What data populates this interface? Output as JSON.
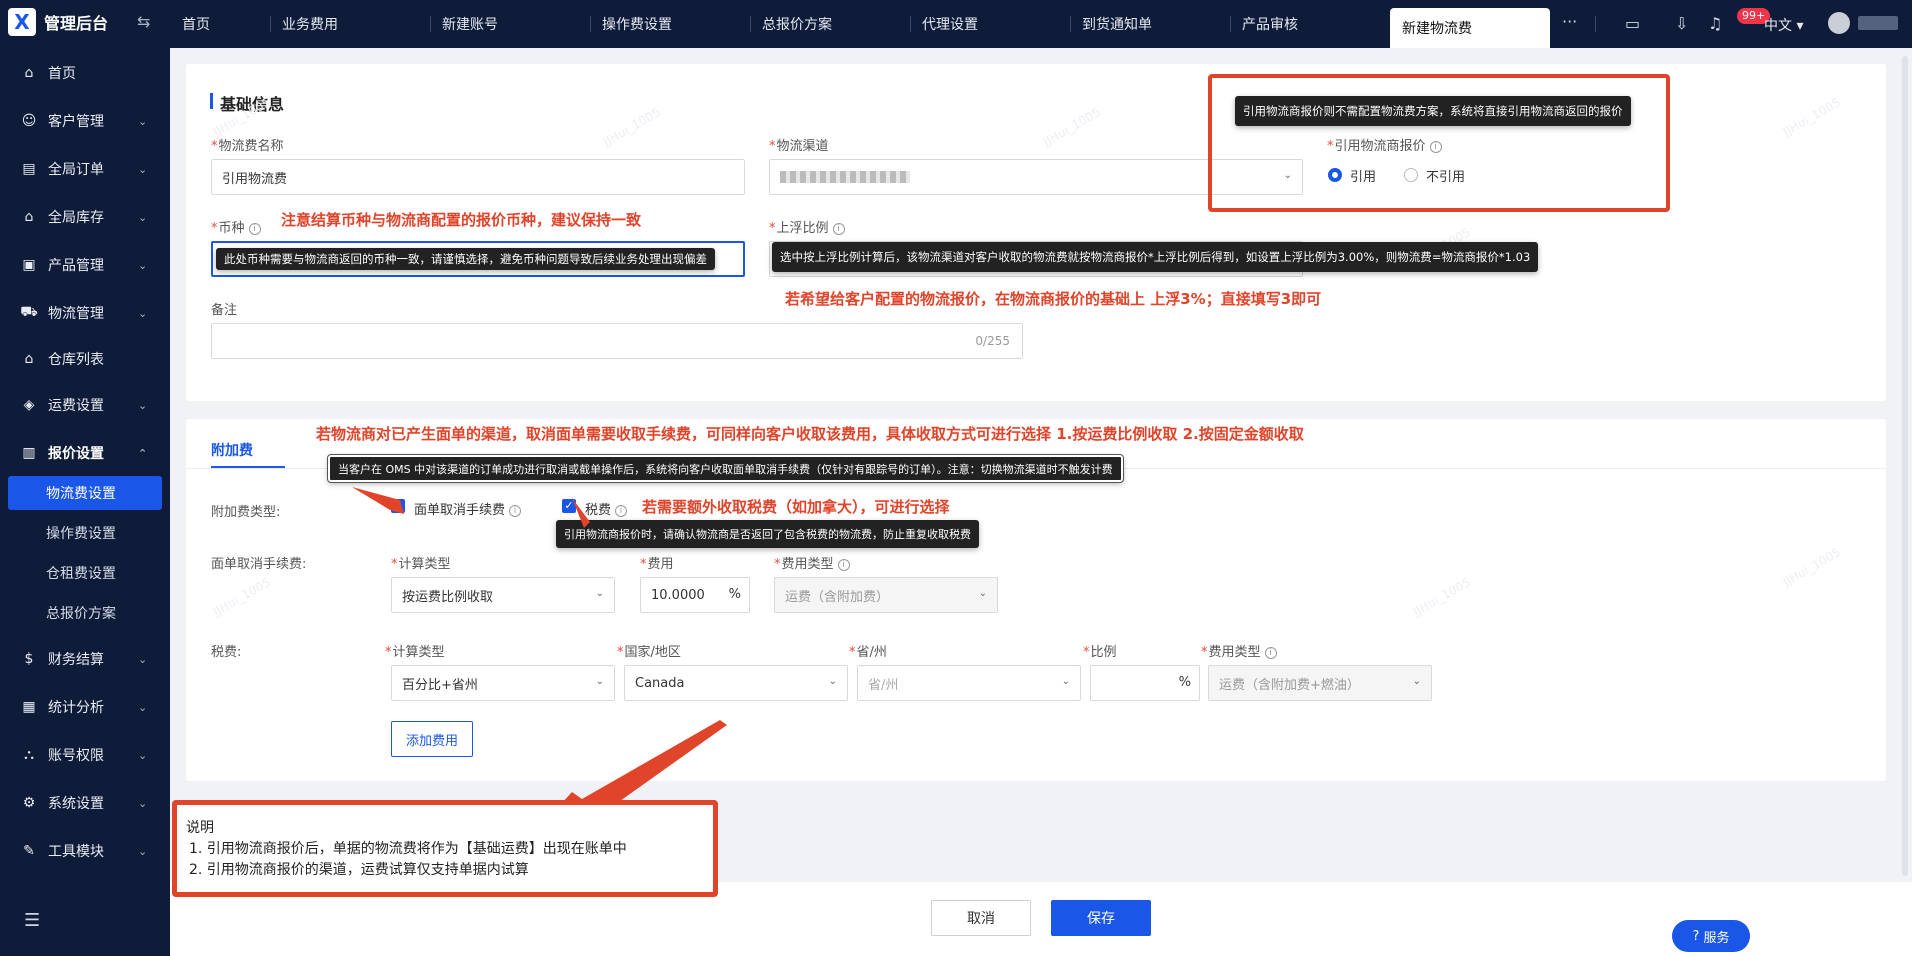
{
  "topbar": {
    "app_title": "管理后台",
    "logo_letter": "X",
    "tabs": [
      "首页",
      "业务费用",
      "新建账号",
      "操作费设置",
      "总报价方案",
      "代理设置",
      "到货通知单",
      "产品审核"
    ],
    "active_tab": "新建物流费",
    "more": "···",
    "badge": "99+",
    "language": "中文"
  },
  "sidebar": {
    "items": [
      {
        "label": "首页",
        "icon": "home-icon",
        "glyph": "⌂"
      },
      {
        "label": "客户管理",
        "icon": "users-icon",
        "glyph": "☺"
      },
      {
        "label": "全局订单",
        "icon": "order-icon",
        "glyph": "▤"
      },
      {
        "label": "全局库存",
        "icon": "warehouse-icon",
        "glyph": "⌂"
      },
      {
        "label": "产品管理",
        "icon": "product-icon",
        "glyph": "▣"
      },
      {
        "label": "物流管理",
        "icon": "truck-icon",
        "glyph": "⛟"
      },
      {
        "label": "仓库列表",
        "icon": "storage-icon",
        "glyph": "⌂"
      },
      {
        "label": "运费设置",
        "icon": "freight-icon",
        "glyph": "◈"
      },
      {
        "label": "报价设置",
        "icon": "quote-icon",
        "glyph": "▥"
      },
      {
        "label": "财务结算",
        "icon": "finance-icon",
        "glyph": "$"
      },
      {
        "label": "统计分析",
        "icon": "chart-icon",
        "glyph": "▦"
      },
      {
        "label": "账号权限",
        "icon": "org-icon",
        "glyph": "⛬"
      },
      {
        "label": "系统设置",
        "icon": "settings-icon",
        "glyph": "⚙"
      },
      {
        "label": "工具模块",
        "icon": "tool-icon",
        "glyph": "✎"
      }
    ],
    "sub_items": [
      "物流费设置",
      "操作费设置",
      "仓租费设置",
      "总报价方案"
    ]
  },
  "basic": {
    "section_title": "基础信息",
    "name_label": "物流费名称",
    "name_value": "引用物流费",
    "channel_label": "物流渠道",
    "quote_label": "引用物流商报价",
    "radio_yes": "引用",
    "radio_no": "不引用",
    "currency_label": "币种",
    "float_label": "上浮比例",
    "remark_label": "备注",
    "remark_count": "0/255"
  },
  "tooltips": {
    "quote": "引用物流商报价则不需配置物流费方案，系统将直接引用物流商返回的报价",
    "currency": "此处币种需要与物流商返回的币种一致，请谨慎选择，避免币种问题导致后续业务处理出现偏差",
    "float": "选中按上浮比例计算后，该物流渠道对客户收取的物流费就按物流商报价*上浮比例后得到，如设置上浮比例为3.00%，则物流费=物流商报价*1.03",
    "cancel_fee": "当客户在 OMS 中对该渠道的订单成功进行取消或截单操作后，系统将向客户收取面单取消手续费（仅针对有跟踪号的订单）。注意：切换物流渠道时不触发计费",
    "tax": "引用物流商报价时，请确认物流商是否返回了包含税费的物流费，防止重复收取税费"
  },
  "annotations": {
    "currency": "注意结算币种与物流商配置的报价币种，建议保持一致",
    "float": "若希望给客户配置的物流报价，在物流商报价的基础上 上浮3%；直接填写3即可",
    "cancel": "若物流商对已产生面单的渠道，取消面单需要收取手续费，可同样向客户收取该费用，具体收取方式可进行选择 1.按运费比例收取  2.按固定金额收取",
    "tax": "若需要额外收取税费（如加拿大），可进行选择"
  },
  "surcharge": {
    "tab": "附加费",
    "type_label": "附加费类型:",
    "check_cancel": "面单取消手续费",
    "check_tax": "税费",
    "cancel_row_label": "面单取消手续费:",
    "calc_type_label": "计算类型",
    "calc_type_value": "按运费比例收取",
    "fee_label": "费用",
    "fee_value": "10.0000",
    "fee_unit": "%",
    "fee_type_label": "费用类型",
    "fee_type_value": "运费（含附加费）",
    "tax_row_label": "税费:",
    "tax_calc_value": "百分比+省州",
    "country_label": "国家/地区",
    "country_value": "Canada",
    "province_label": "省/州",
    "province_placeholder": "省/州",
    "ratio_label": "比例",
    "ratio_unit": "%",
    "tax_fee_type_value": "运费（含附加费+燃油）",
    "add_button": "添加费用"
  },
  "notes": {
    "title": "说明",
    "line1": "1. 引用物流商报价后，单据的物流费将作为【基础运费】出现在账单中",
    "line2": "2. 引用物流商报价的渠道，运费试算仅支持单据内试算"
  },
  "footer": {
    "cancel": "取消",
    "save": "保存",
    "service": "服务"
  },
  "watermark": "JJHui_1005",
  "colors": {
    "accent": "#1a56e8",
    "annotation": "#e0442a",
    "sidebar": "#0e1c3a"
  }
}
